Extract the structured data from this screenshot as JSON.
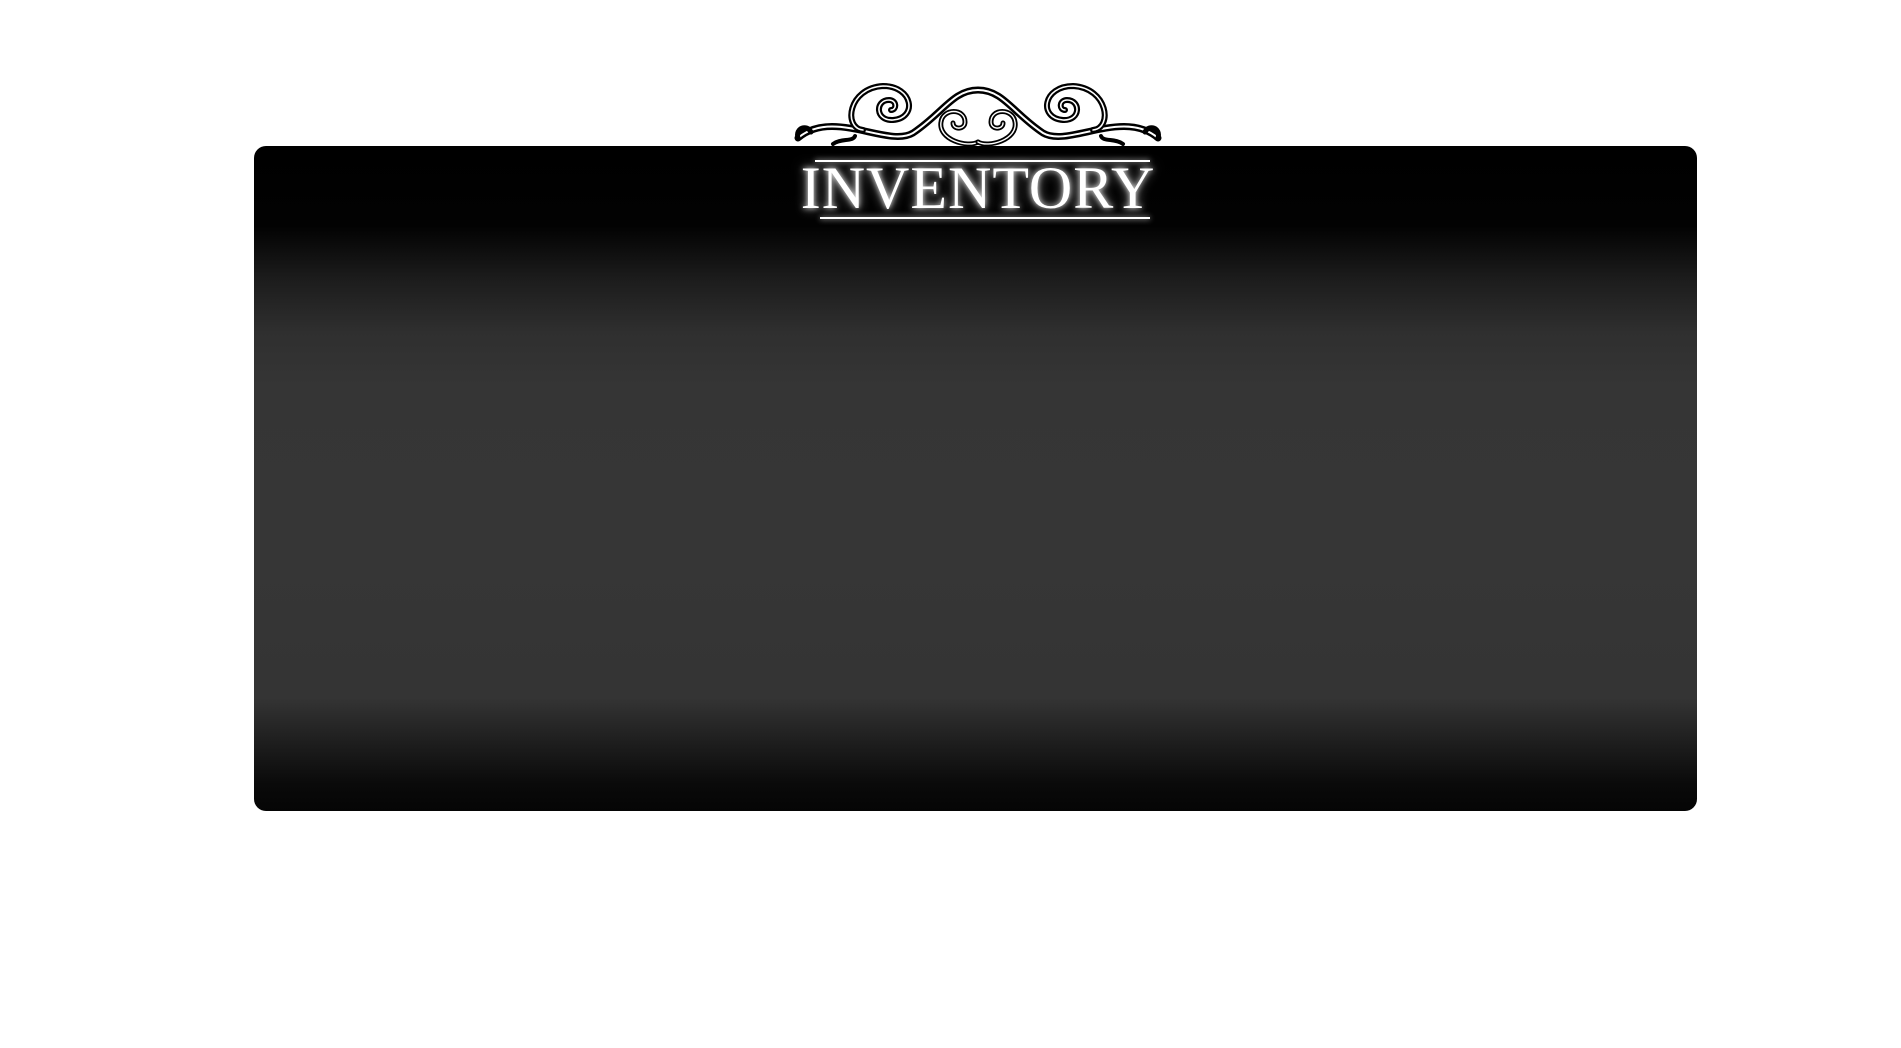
{
  "inventory": {
    "title": "INVENTORY",
    "ornament_icon": "scroll-ornament-icon"
  },
  "colors": {
    "page_background": "#ffffff",
    "panel_dark": "#000000",
    "panel_mid": "#363636",
    "title_text": "#ffffff"
  }
}
